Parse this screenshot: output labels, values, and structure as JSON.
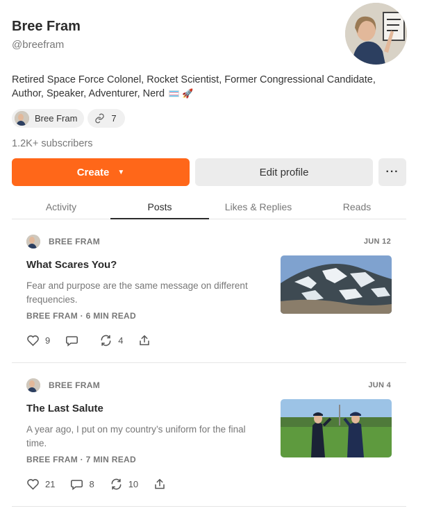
{
  "profile": {
    "name": "Bree Fram",
    "handle": "@breefram",
    "bio": "Retired Space Force Colonel, Rocket Scientist, Former Congressional Candidate, Author, Speaker, Adventurer, Nerd",
    "bio_emoji_rocket": "🚀",
    "subscribers": "1.2K+ subscribers"
  },
  "chips": {
    "name_chip": "Bree Fram",
    "links_count": "7"
  },
  "actions": {
    "create_label": "Create",
    "create_caret": "▼",
    "edit_label": "Edit profile",
    "more_label": "···"
  },
  "tabs": [
    "Activity",
    "Posts",
    "Likes & Replies",
    "Reads"
  ],
  "posts": [
    {
      "author": "BREE FRAM",
      "date": "JUN 12",
      "title": "What Scares You?",
      "subtitle": "Fear and purpose are the same message on different frequencies.",
      "byline": "BREE FRAM · 6 MIN READ",
      "likes": "9",
      "comments": "",
      "restacks": "4"
    },
    {
      "author": "BREE FRAM",
      "date": "JUN 4",
      "title": "The Last Salute",
      "subtitle": "A year ago, I put on my country’s uniform for the final time.",
      "byline": "BREE FRAM · 7 MIN READ",
      "likes": "21",
      "comments": "8",
      "restacks": "10"
    }
  ],
  "colors": {
    "accent": "#ff6719",
    "button_gray": "#ececec",
    "muted_text": "#777777"
  },
  "icons": [
    "link-icon",
    "heart-icon",
    "comment-icon",
    "restack-icon",
    "share-icon",
    "caret-down-icon",
    "more-icon"
  ]
}
